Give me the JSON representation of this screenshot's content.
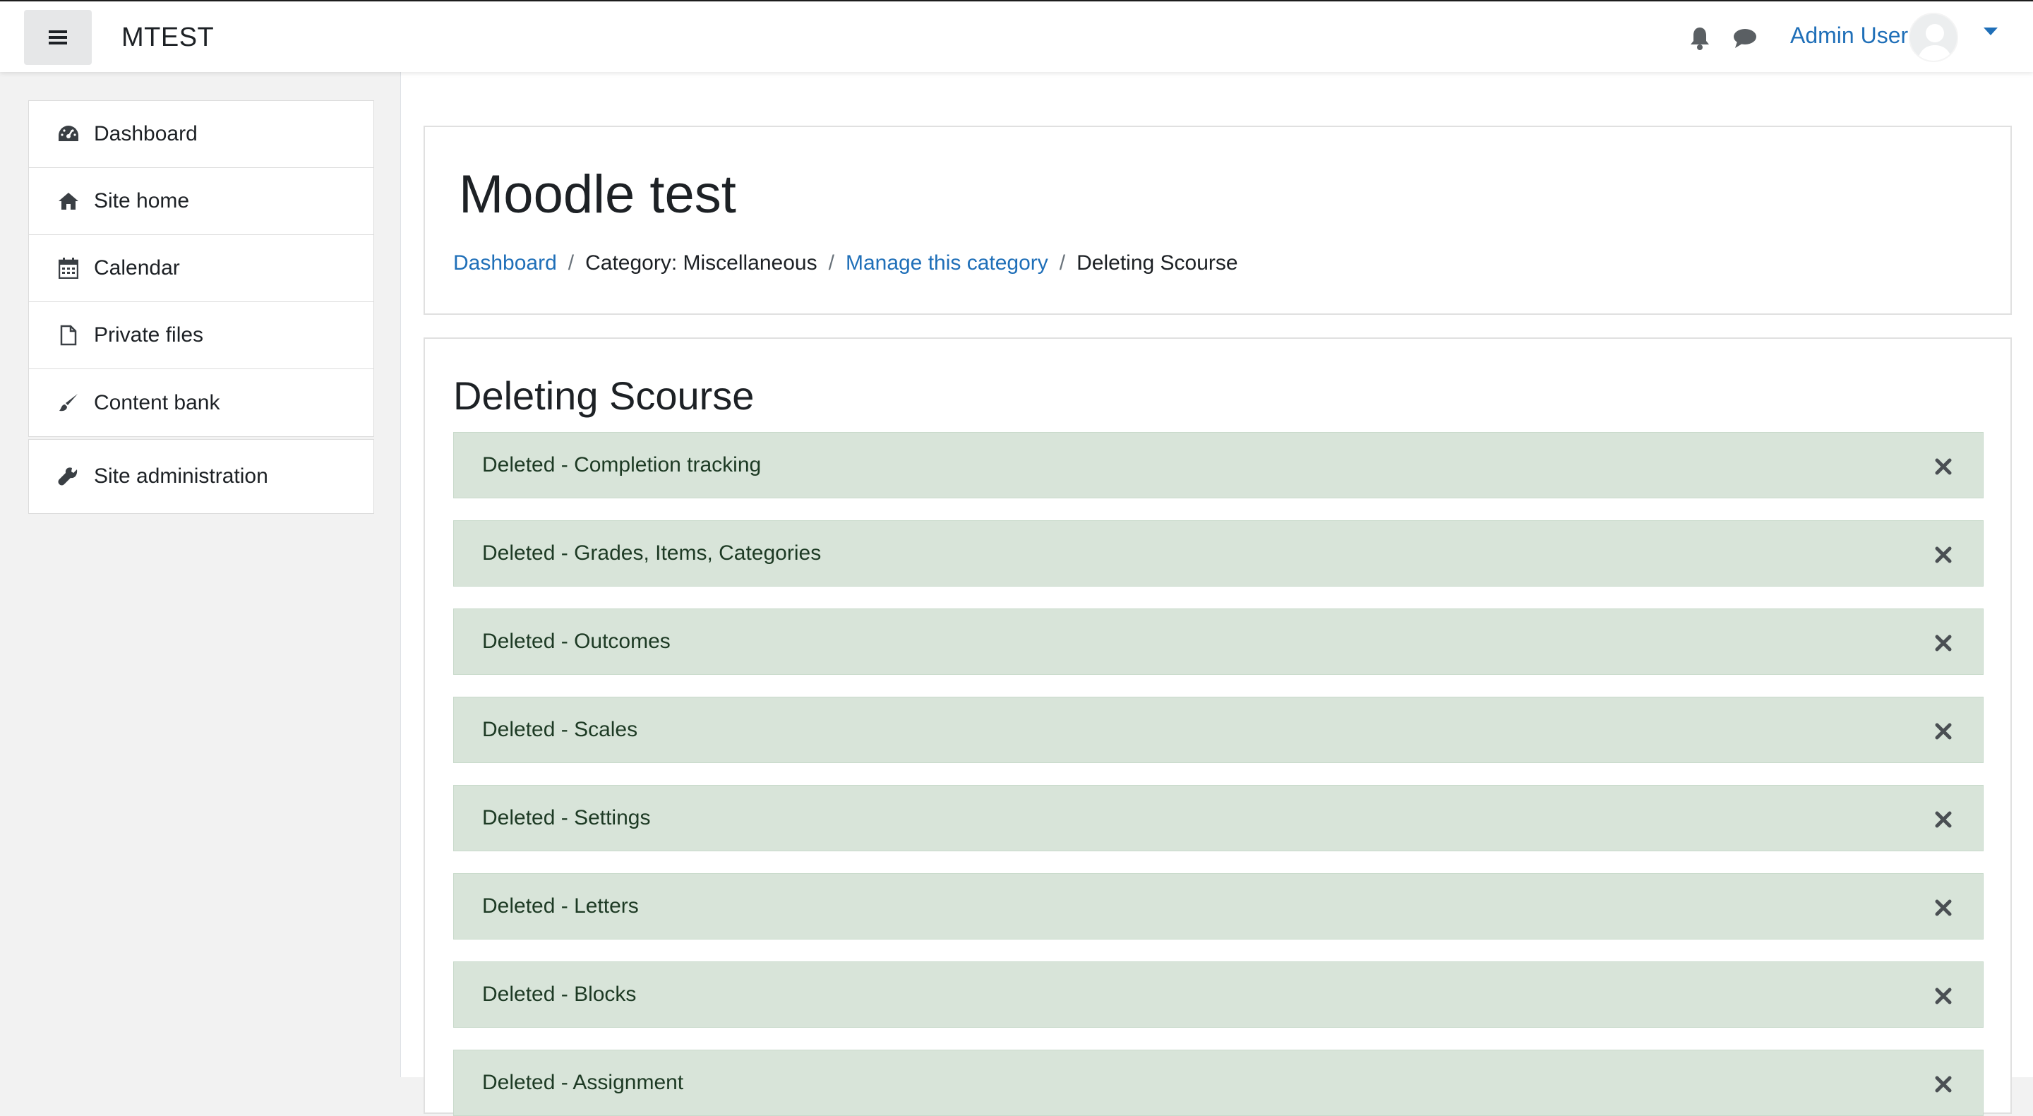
{
  "navbar": {
    "site_name": "MTEST",
    "user_name": "Admin User",
    "icons": [
      "hamburger-icon",
      "bell-icon",
      "chat-icon",
      "avatar",
      "caret-down-icon"
    ]
  },
  "sidebar": {
    "items": [
      {
        "label": "Dashboard",
        "icon": "dashboard-icon"
      },
      {
        "label": "Site home",
        "icon": "home-icon"
      },
      {
        "label": "Calendar",
        "icon": "calendar-icon"
      },
      {
        "label": "Private files",
        "icon": "file-icon"
      },
      {
        "label": "Content bank",
        "icon": "brush-icon"
      }
    ],
    "admin_item": {
      "label": "Site administration",
      "icon": "wrench-icon"
    }
  },
  "header": {
    "title": "Moodle test",
    "breadcrumb": [
      {
        "label": "Dashboard",
        "link": true
      },
      {
        "label": "Category: Miscellaneous",
        "link": false
      },
      {
        "label": "Manage this category",
        "link": true
      },
      {
        "label": "Deleting Scourse",
        "link": false
      }
    ]
  },
  "main": {
    "heading": "Deleting Scourse",
    "alerts": [
      "Deleted - Completion tracking",
      "Deleted - Grades, Items, Categories",
      "Deleted - Outcomes",
      "Deleted - Scales",
      "Deleted - Settings",
      "Deleted - Letters",
      "Deleted - Blocks",
      "Deleted - Assignment"
    ]
  },
  "colors": {
    "link": "#1f6fb8",
    "alert_bg": "#d8e4d9",
    "alert_text": "#1d3a24",
    "drawer_bg": "#f2f2f2"
  }
}
